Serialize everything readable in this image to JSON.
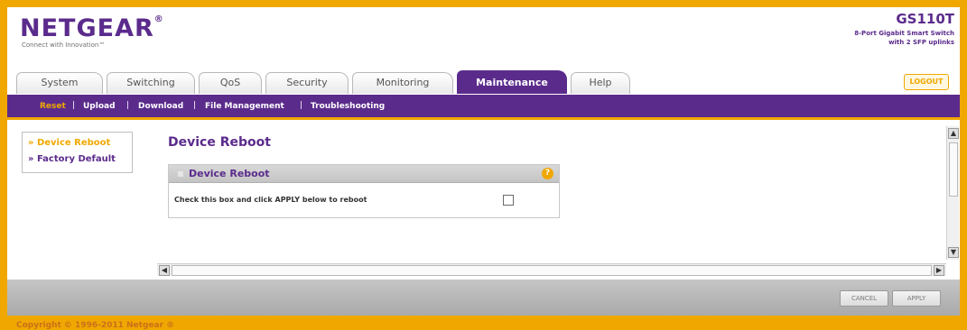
{
  "brand": {
    "logo": "NETGEAR",
    "tagline": "Connect with Innovation™",
    "model": "GS110T",
    "model_desc_1": "8-Port Gigabit Smart Switch",
    "model_desc_2": "with 2 SFP uplinks"
  },
  "logout_label": "LOGOUT",
  "tabs": [
    "System",
    "Switching",
    "QoS",
    "Security",
    "Monitoring",
    "Maintenance",
    "Help"
  ],
  "active_tab": "Maintenance",
  "subnav": [
    "Reset",
    "Upload",
    "Download",
    "File Management",
    "Troubleshooting"
  ],
  "leftmenu": [
    "» Device Reboot",
    "» Factory Default"
  ],
  "page_title": "Device Reboot",
  "panel": {
    "title": "Device Reboot",
    "help": "?",
    "reboot_label": "Check this box and click APPLY below to reboot"
  },
  "buttons": {
    "cancel": "CANCEL",
    "apply": "APPLY"
  },
  "footer": "Copyright © 1996-2011 Netgear ®",
  "colors": {
    "purple": "#5b2b8c",
    "orange": "#f0a800"
  }
}
